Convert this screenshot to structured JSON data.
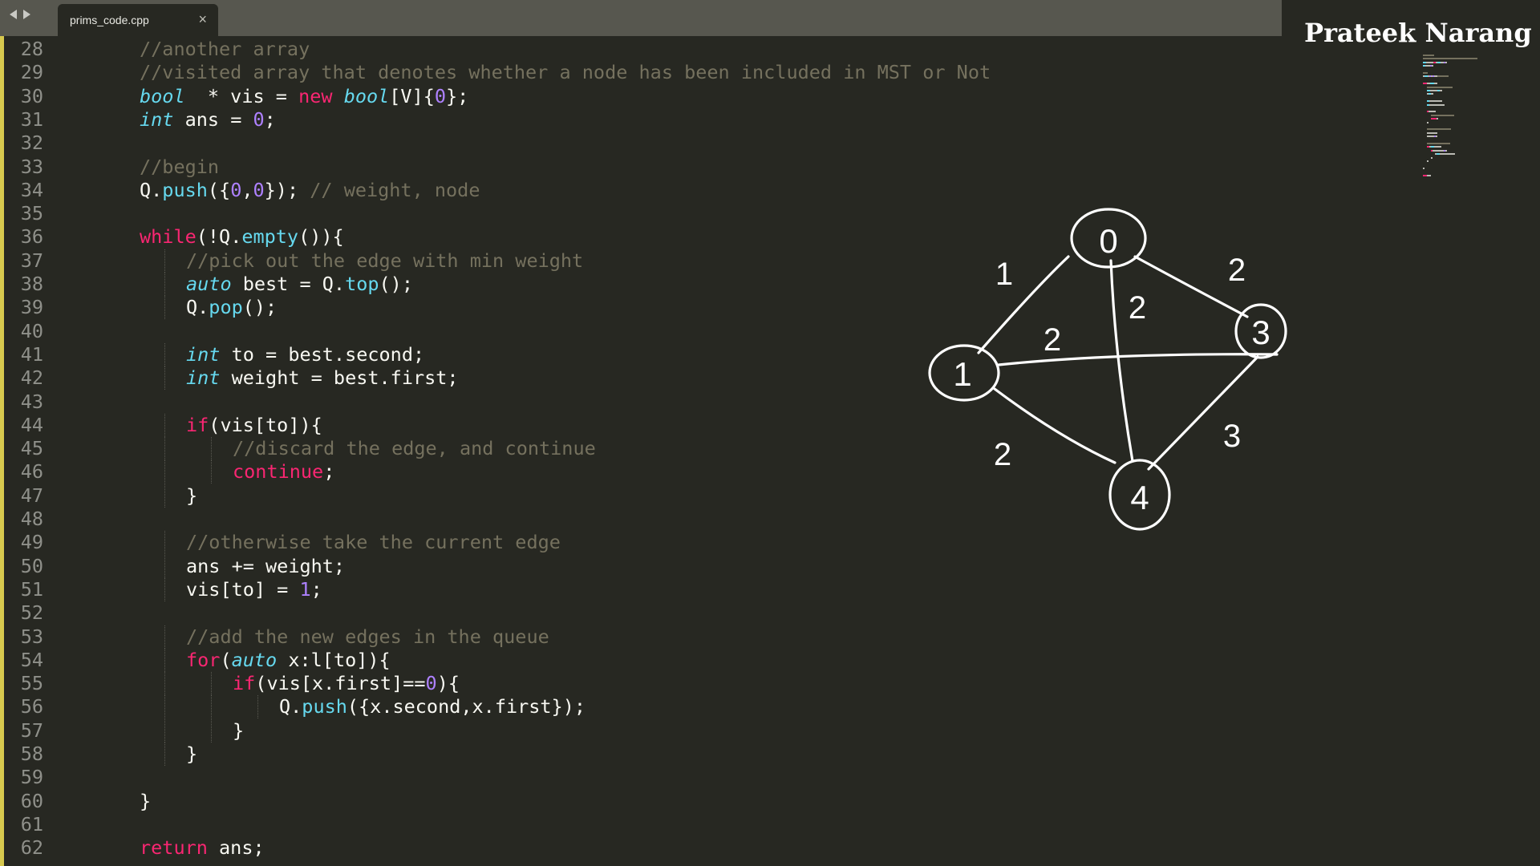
{
  "tab": {
    "title": "prims_code.cpp",
    "close": "×"
  },
  "author": "Prateek Narang",
  "colors": {
    "background": "#272822",
    "tabbar": "#57574f",
    "comment": "#75715e",
    "keyword": "#f92672",
    "type": "#66d9ef",
    "number": "#ae81ff",
    "text": "#f8f8f2",
    "line_number": "#8f908a",
    "indicator": "#d7c94e"
  },
  "icons": [
    "nav-back-icon",
    "nav-forward-icon",
    "close-icon"
  ],
  "code_lines": [
    {
      "n": "28",
      "indent": 2,
      "tokens": [
        [
          "cm",
          "//another array"
        ]
      ]
    },
    {
      "n": "29",
      "indent": 2,
      "tokens": [
        [
          "cm",
          "//visited array that denotes whether a node has been included in MST or Not"
        ]
      ]
    },
    {
      "n": "30",
      "indent": 2,
      "tokens": [
        [
          "ty",
          "bool"
        ],
        [
          "",
          "  * vis = "
        ],
        [
          "kw",
          "new"
        ],
        [
          "",
          " "
        ],
        [
          "ty",
          "bool"
        ],
        [
          "",
          "[V]{"
        ],
        [
          "nu",
          "0"
        ],
        [
          "",
          "};"
        ]
      ]
    },
    {
      "n": "31",
      "indent": 2,
      "tokens": [
        [
          "ty",
          "int"
        ],
        [
          "",
          " ans = "
        ],
        [
          "nu",
          "0"
        ],
        [
          "",
          ";"
        ]
      ]
    },
    {
      "n": "32",
      "indent": 0,
      "tokens": []
    },
    {
      "n": "33",
      "indent": 2,
      "tokens": [
        [
          "cm",
          "//begin"
        ]
      ]
    },
    {
      "n": "34",
      "indent": 2,
      "tokens": [
        [
          "",
          "Q."
        ],
        [
          "fn",
          "push"
        ],
        [
          "",
          "({"
        ],
        [
          "nu",
          "0"
        ],
        [
          "",
          ","
        ],
        [
          "nu",
          "0"
        ],
        [
          "",
          "}); "
        ],
        [
          "cm",
          "// weight, node"
        ]
      ]
    },
    {
      "n": "35",
      "indent": 0,
      "tokens": []
    },
    {
      "n": "36",
      "indent": 2,
      "tokens": [
        [
          "kw",
          "while"
        ],
        [
          "",
          "(!Q."
        ],
        [
          "fn",
          "empty"
        ],
        [
          "",
          "()){"
        ]
      ]
    },
    {
      "n": "37",
      "indent": 3,
      "tokens": [
        [
          "cm",
          "//pick out the edge with min weight"
        ]
      ]
    },
    {
      "n": "38",
      "indent": 3,
      "tokens": [
        [
          "ty",
          "auto"
        ],
        [
          "",
          " best = Q."
        ],
        [
          "fn",
          "top"
        ],
        [
          "",
          "();"
        ]
      ]
    },
    {
      "n": "39",
      "indent": 3,
      "tokens": [
        [
          "",
          "Q."
        ],
        [
          "fn",
          "pop"
        ],
        [
          "",
          "();"
        ]
      ]
    },
    {
      "n": "40",
      "indent": 0,
      "tokens": []
    },
    {
      "n": "41",
      "indent": 3,
      "tokens": [
        [
          "ty",
          "int"
        ],
        [
          "",
          " to = best.second;"
        ]
      ]
    },
    {
      "n": "42",
      "indent": 3,
      "tokens": [
        [
          "ty",
          "int"
        ],
        [
          "",
          " weight = best.first;"
        ]
      ]
    },
    {
      "n": "43",
      "indent": 0,
      "tokens": []
    },
    {
      "n": "44",
      "indent": 3,
      "tokens": [
        [
          "kw",
          "if"
        ],
        [
          "",
          "(vis[to]){"
        ]
      ]
    },
    {
      "n": "45",
      "indent": 4,
      "tokens": [
        [
          "cm",
          "//discard the edge, and continue"
        ]
      ]
    },
    {
      "n": "46",
      "indent": 4,
      "tokens": [
        [
          "kw",
          "continue"
        ],
        [
          "",
          ";"
        ]
      ]
    },
    {
      "n": "47",
      "indent": 3,
      "tokens": [
        [
          "",
          "}"
        ]
      ]
    },
    {
      "n": "48",
      "indent": 0,
      "tokens": []
    },
    {
      "n": "49",
      "indent": 3,
      "tokens": [
        [
          "cm",
          "//otherwise take the current edge"
        ]
      ]
    },
    {
      "n": "50",
      "indent": 3,
      "tokens": [
        [
          "",
          "ans += weight;"
        ]
      ]
    },
    {
      "n": "51",
      "indent": 3,
      "tokens": [
        [
          "",
          "vis[to] = "
        ],
        [
          "nu",
          "1"
        ],
        [
          "",
          ";"
        ]
      ]
    },
    {
      "n": "52",
      "indent": 0,
      "tokens": []
    },
    {
      "n": "53",
      "indent": 3,
      "tokens": [
        [
          "cm",
          "//add the new edges in the queue"
        ]
      ]
    },
    {
      "n": "54",
      "indent": 3,
      "tokens": [
        [
          "kw",
          "for"
        ],
        [
          "",
          "("
        ],
        [
          "ty",
          "auto"
        ],
        [
          "",
          " x:l[to]){"
        ]
      ]
    },
    {
      "n": "55",
      "indent": 4,
      "tokens": [
        [
          "kw",
          "if"
        ],
        [
          "",
          "(vis[x.first]=="
        ],
        [
          "nu",
          "0"
        ],
        [
          "",
          "){"
        ]
      ]
    },
    {
      "n": "56",
      "indent": 5,
      "tokens": [
        [
          "",
          "Q."
        ],
        [
          "fn",
          "push"
        ],
        [
          "",
          "({x.second,x.first});"
        ]
      ]
    },
    {
      "n": "57",
      "indent": 4,
      "tokens": [
        [
          "",
          "}"
        ]
      ]
    },
    {
      "n": "58",
      "indent": 3,
      "tokens": [
        [
          "",
          "}"
        ]
      ]
    },
    {
      "n": "59",
      "indent": 0,
      "tokens": []
    },
    {
      "n": "60",
      "indent": 2,
      "tokens": [
        [
          "",
          "}"
        ]
      ]
    },
    {
      "n": "61",
      "indent": 0,
      "tokens": []
    },
    {
      "n": "62",
      "indent": 2,
      "tokens": [
        [
          "kw",
          "return"
        ],
        [
          "",
          " ans;"
        ]
      ]
    }
  ],
  "graph": {
    "nodes": [
      "0",
      "1",
      "3",
      "4"
    ],
    "edges": [
      {
        "from": "0",
        "to": "1",
        "weight": "1"
      },
      {
        "from": "0",
        "to": "3",
        "weight": "2"
      },
      {
        "from": "0",
        "to": "4",
        "weight": "2"
      },
      {
        "from": "1",
        "to": "3",
        "weight": "2"
      },
      {
        "from": "1",
        "to": "4",
        "weight": "2"
      },
      {
        "from": "3",
        "to": "4",
        "weight": "3"
      }
    ]
  }
}
